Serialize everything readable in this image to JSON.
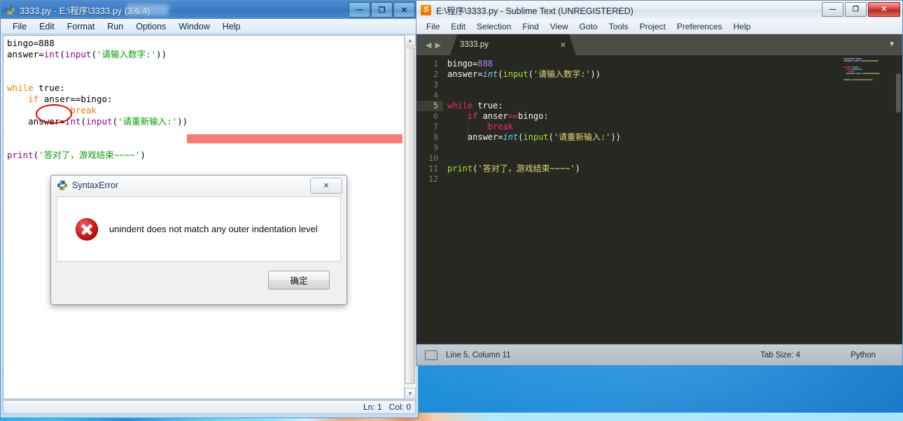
{
  "idle": {
    "title": "3333.py - E:\\程序\\3333.py (3.6.4)",
    "icon": "python-logo-icon",
    "window_buttons": [
      {
        "name": "minimize-button",
        "glyph": "—"
      },
      {
        "name": "maximize-button",
        "glyph": "❐"
      },
      {
        "name": "close-button",
        "glyph": "✕"
      }
    ],
    "menu": [
      "File",
      "Edit",
      "Format",
      "Run",
      "Options",
      "Window",
      "Help"
    ],
    "code_lines": [
      "bingo=888",
      "answer=int(input('请输入数字:'))",
      "",
      "",
      "while true:",
      "    if anser==bingo:",
      "            break",
      "    answer=int(input('请重新输入:'))",
      "",
      "",
      "print('答对了，游戏结束~~~~')"
    ],
    "annotation": {
      "type": "red-ellipse",
      "target_text": "true:",
      "color": "#e80000"
    },
    "error_highlight": {
      "color": "#fb7c74",
      "line": "answer=int(input('请重新输入:'))"
    },
    "status": {
      "ln": "Ln: 1",
      "col": "Col: 0"
    }
  },
  "dialog": {
    "title": "SyntaxError",
    "icon": "python-logo-icon",
    "close_glyph": "✕",
    "message": "unindent does not match any outer indentation level",
    "ok_label": "确定",
    "error_icon": "error-cross-icon"
  },
  "sublime": {
    "title": "E:\\程序\\3333.py - Sublime Text (UNREGISTERED)",
    "icon_letter": "S",
    "window_buttons": [
      {
        "name": "minimize-button",
        "glyph": "—"
      },
      {
        "name": "maximize-button",
        "glyph": "❐"
      },
      {
        "name": "close-button",
        "glyph": "✕"
      }
    ],
    "menu": [
      "File",
      "Edit",
      "Selection",
      "Find",
      "View",
      "Goto",
      "Tools",
      "Project",
      "Preferences",
      "Help"
    ],
    "tab": {
      "label": "3333.py",
      "close_glyph": "✕"
    },
    "tab_nav": {
      "prev": "◀",
      "next": "▶",
      "dropdown": "▼"
    },
    "gutter_numbers": [
      "1",
      "2",
      "3",
      "4",
      "5",
      "6",
      "7",
      "8",
      "9",
      "10",
      "11",
      "12"
    ],
    "active_line": 5,
    "code_lines": [
      "bingo=888",
      "answer=int(input('请输入数字:'))",
      "",
      "",
      "while true:",
      "    if anser==bingo:",
      "        break",
      "    answer=int(input('请重新输入:'))",
      "",
      "",
      "print('答对了，游戏结束~~~~')",
      ""
    ],
    "statusbar": {
      "position": "Line 5, Column 11",
      "tab_size": "Tab Size: 4",
      "syntax": "Python"
    },
    "theme_colors": {
      "background": "#272822",
      "keyword": "#f92672",
      "number": "#ae81ff",
      "string": "#e6db74",
      "function": "#66d9ef",
      "call": "#a6e22e"
    }
  }
}
